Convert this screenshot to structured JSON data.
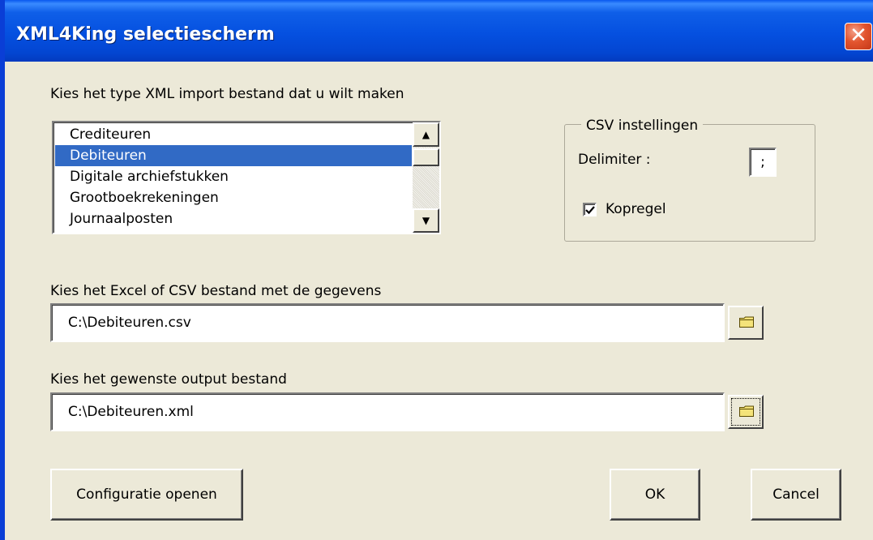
{
  "window": {
    "title": "XML4King selectiescherm",
    "close_glyph": "✕"
  },
  "type_section": {
    "label": "Kies het type XML import bestand dat u wilt maken",
    "items": [
      "Crediteuren",
      "Debiteuren",
      "Digitale archiefstukken",
      "Grootboekrekeningen",
      "Journaalposten"
    ],
    "selected_index": 1,
    "scroll_up_glyph": "▲",
    "scroll_down_glyph": "▼"
  },
  "csv_settings": {
    "title": "CSV instellingen",
    "delimiter_label": "Delimiter :",
    "delimiter_value": ";",
    "header_label": "Kopregel",
    "header_checked": true
  },
  "input_section": {
    "label": "Kies het Excel of CSV bestand met de gegevens",
    "value": "C:\\Debiteuren.csv",
    "browse_icon": "folder-icon"
  },
  "output_section": {
    "label": "Kies het gewenste output bestand",
    "value": "C:\\Debiteuren.xml",
    "browse_icon": "folder-icon"
  },
  "buttons": {
    "open_config": "Configuratie openen",
    "ok": "OK",
    "cancel": "Cancel"
  },
  "colors": {
    "titlebar": "#0550e0",
    "selection": "#316ac5",
    "face": "#ece9d8",
    "folder": "#f4e37a"
  }
}
